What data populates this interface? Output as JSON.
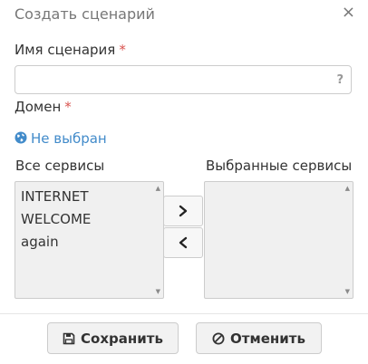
{
  "dialog": {
    "title": "Создать сценарий",
    "close_glyph": "×"
  },
  "form": {
    "name_label": "Имя сценария",
    "required_mark": "*",
    "name_value": "",
    "help_glyph": "?",
    "domain_label": "Домен",
    "domain_value": "Не выбран"
  },
  "services": {
    "available_label": "Все сервисы",
    "selected_label": "Выбранные сервисы",
    "available": [
      "INTERNET",
      "WELCOME",
      "again"
    ],
    "selected": []
  },
  "footer": {
    "save_label": "Сохранить",
    "cancel_label": "Отменить"
  },
  "colors": {
    "link": "#428bca",
    "required": "#d9534f",
    "list_bg": "#f0f0f0"
  }
}
